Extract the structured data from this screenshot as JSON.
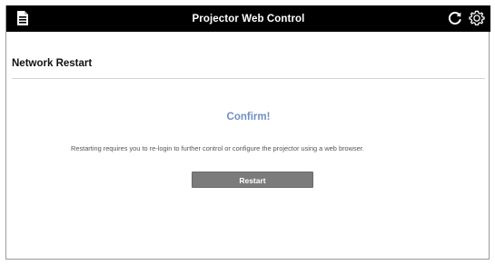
{
  "header": {
    "title": "Projector Web Control",
    "menu_icon": "document-menu-icon",
    "refresh_icon": "refresh-icon",
    "settings_icon": "gear-icon"
  },
  "page": {
    "title": "Network Restart"
  },
  "dialog": {
    "heading": "Confirm!",
    "message": "Restarting requires you to re-login to further control or configure the projector using a web browser.",
    "restart_label": "Restart"
  },
  "colors": {
    "header_bg": "#000000",
    "accent": "#6f8fc4",
    "button_bg": "#7b7b7b"
  }
}
